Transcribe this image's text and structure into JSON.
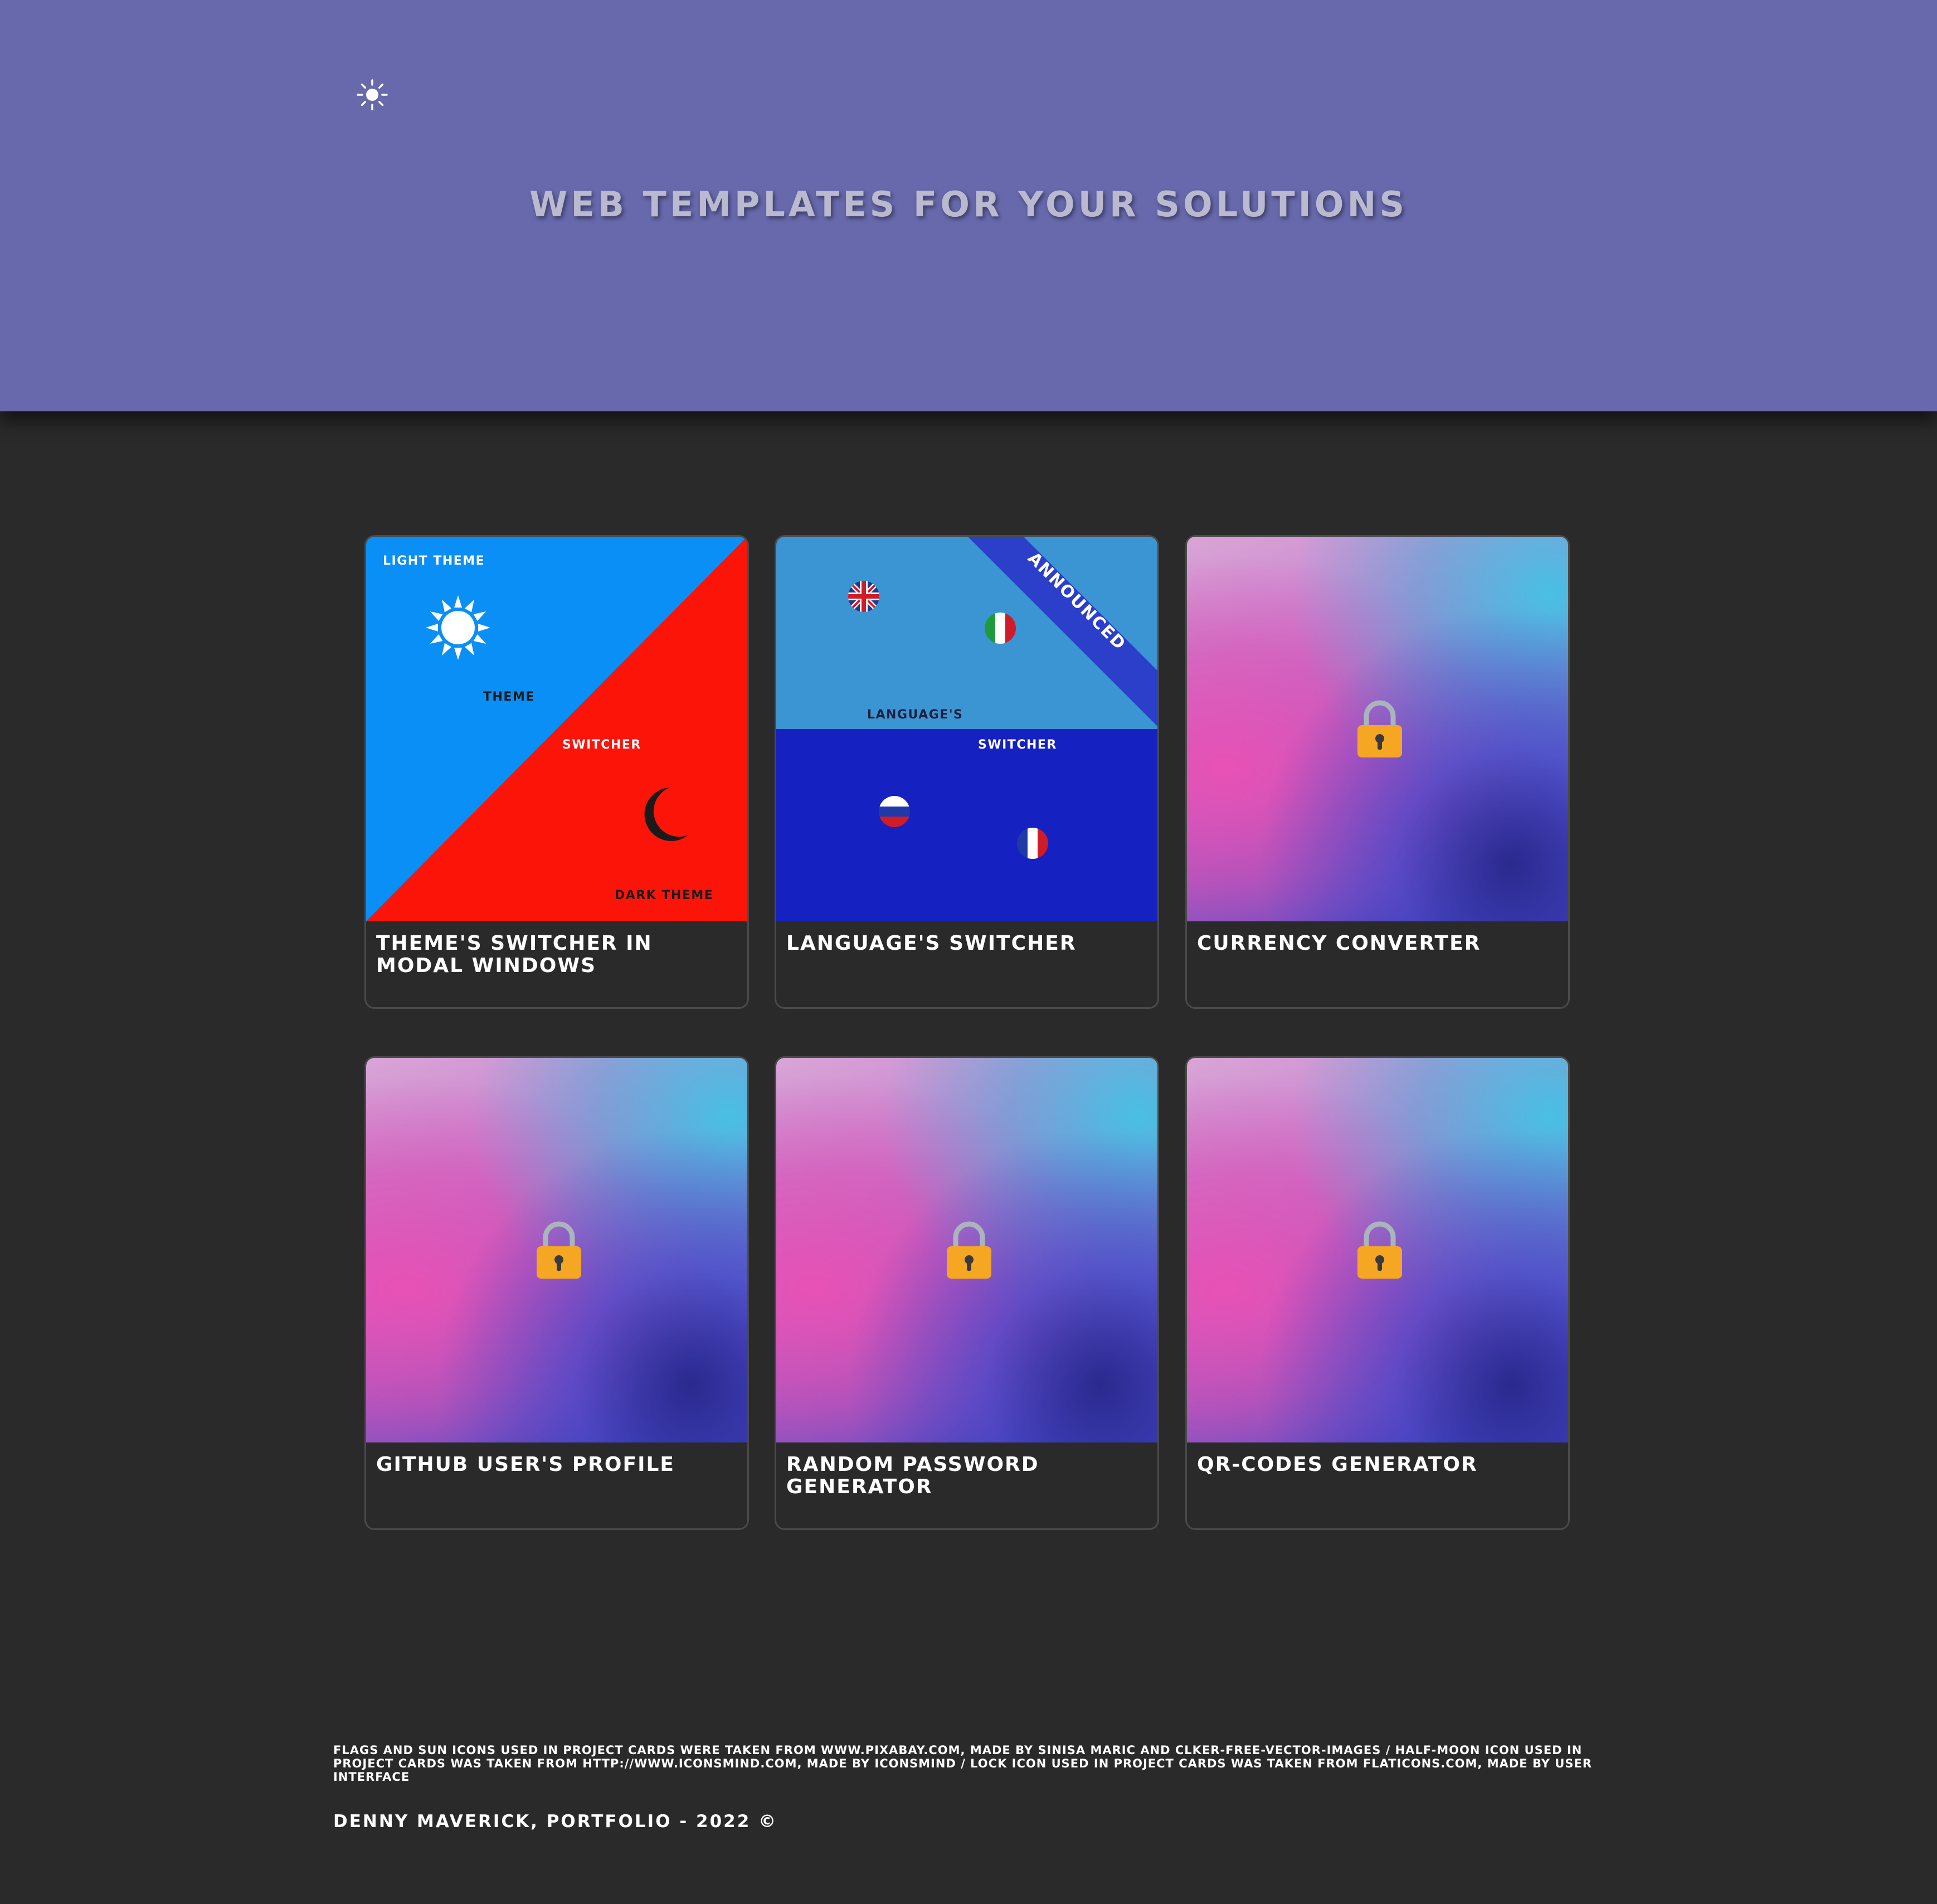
{
  "header": {
    "title": "WEB TEMPLATES FOR YOUR SOLUTIONS",
    "theme_toggle_icon": "sun-icon",
    "background_color": "#6869ad"
  },
  "cards": [
    {
      "title": "THEME'S SWITCHER IN MODAL WINDOWS",
      "image": {
        "light_label": "LIGHT THEME",
        "theme_label": "THEME",
        "switcher_label": "SWITCHER",
        "dark_label": "DARK THEME",
        "icons": [
          "sun-icon",
          "half-moon-icon"
        ],
        "colors": {
          "light": "#0a8ff6",
          "dark": "#fd1409"
        }
      }
    },
    {
      "title": "LANGUAGE'S SWITCHER",
      "image": {
        "ribbon": "ANNOUNCED",
        "languages_label": "LANGUAGE'S",
        "switcher_label": "SWITCHER",
        "icons": [
          "uk-flag-icon",
          "italy-flag-icon",
          "russia-flag-icon",
          "france-flag-icon"
        ],
        "colors": {
          "top": "#3c95d3",
          "bottom": "#1621c1",
          "ribbon": "#2b3fcb"
        }
      }
    },
    {
      "title": "CURRENCY CONVERTER",
      "image": {
        "icon": "lock-icon"
      }
    },
    {
      "title": "GITHUB USER'S PROFILE",
      "image": {
        "icon": "lock-icon"
      }
    },
    {
      "title": "RANDOM PASSWORD GENERATOR",
      "image": {
        "icon": "lock-icon"
      }
    },
    {
      "title": "QR-CODES GENERATOR",
      "image": {
        "icon": "lock-icon"
      }
    }
  ],
  "footer": {
    "credits": "FLAGS AND SUN ICONS USED IN PROJECT CARDS WERE TAKEN FROM WWW.PIXABAY.COM, MADE BY SINISA MARIC AND CLKER-FREE-VECTOR-IMAGES / HALF-MOON ICON USED IN PROJECT CARDS WAS TAKEN FROM HTTP://WWW.ICONSMIND.COM, MADE BY ICONSMIND / LOCK ICON USED IN PROJECT CARDS WAS TAKEN FROM FLATICONS.COM, MADE BY USER INTERFACE",
    "copyright": "DENNY MAVERICK, PORTFOLIO - 2022 ©"
  }
}
